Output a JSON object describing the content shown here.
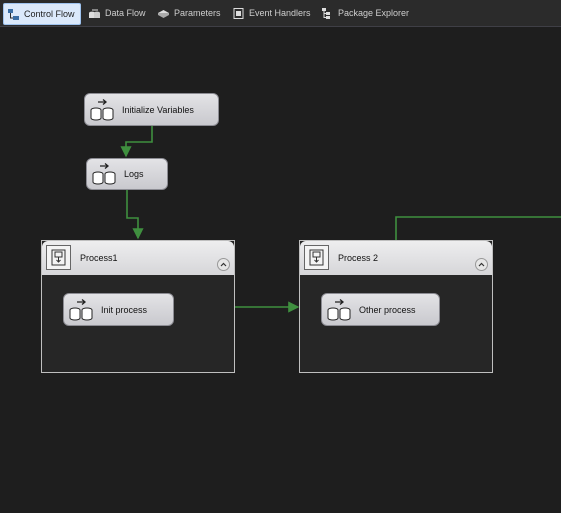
{
  "tabs": [
    {
      "label": "Control Flow",
      "icon": "control-flow-icon",
      "active": true
    },
    {
      "label": "Data Flow",
      "icon": "data-flow-icon",
      "active": false
    },
    {
      "label": "Parameters",
      "icon": "parameters-icon",
      "active": false
    },
    {
      "label": "Event Handlers",
      "icon": "event-handlers-icon",
      "active": false
    },
    {
      "label": "Package Explorer",
      "icon": "package-explorer-icon",
      "active": false
    }
  ],
  "tasks": {
    "initialize_variables": "Initialize Variables",
    "logs": "Logs"
  },
  "containers": [
    {
      "title": "Process1",
      "task": "Init process"
    },
    {
      "title": "Process 2",
      "task": "Other process"
    }
  ],
  "colors": {
    "canvas_background": "#1e1e1e",
    "connector": "#3f8f3f",
    "active_tab": "#dbe9fb"
  }
}
